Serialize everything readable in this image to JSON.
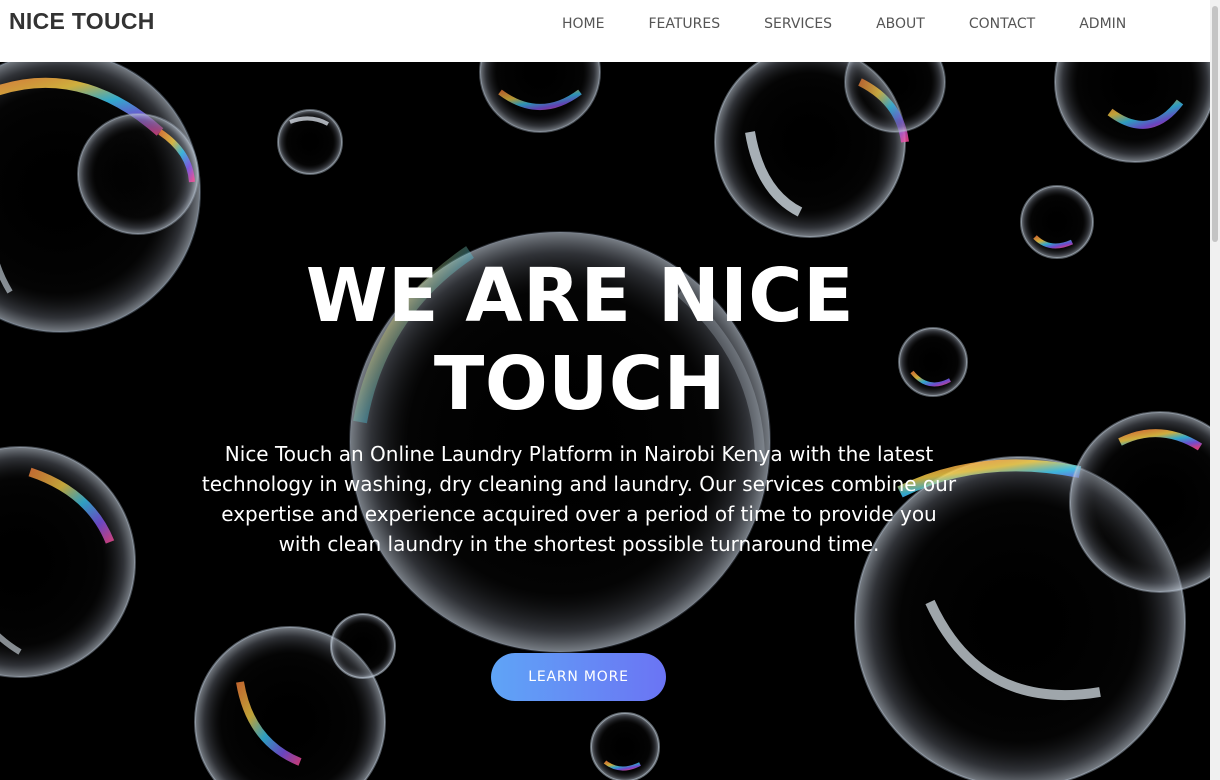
{
  "brand": "NICE TOUCH",
  "nav": {
    "items": [
      {
        "label": "HOME"
      },
      {
        "label": "FEATURES"
      },
      {
        "label": "SERVICES"
      },
      {
        "label": "ABOUT"
      },
      {
        "label": "CONTACT"
      },
      {
        "label": "ADMIN"
      }
    ]
  },
  "hero": {
    "title_line1": "WE ARE NICE",
    "title_line2": "TOUCH",
    "description": "Nice Touch an Online Laundry Platform in Nairobi Kenya with the latest technology in washing, dry cleaning and laundry. Our services combine our expertise and experience acquired over a period of time to provide you with clean laundry in the shortest possible turnaround time.",
    "button_label": "LEARN MORE"
  },
  "colors": {
    "hero_background": "#000000",
    "nav_text": "#555555",
    "brand_text": "#333333",
    "button_gradient_start": "#5fa4f6",
    "button_gradient_end": "#6b74f4"
  }
}
